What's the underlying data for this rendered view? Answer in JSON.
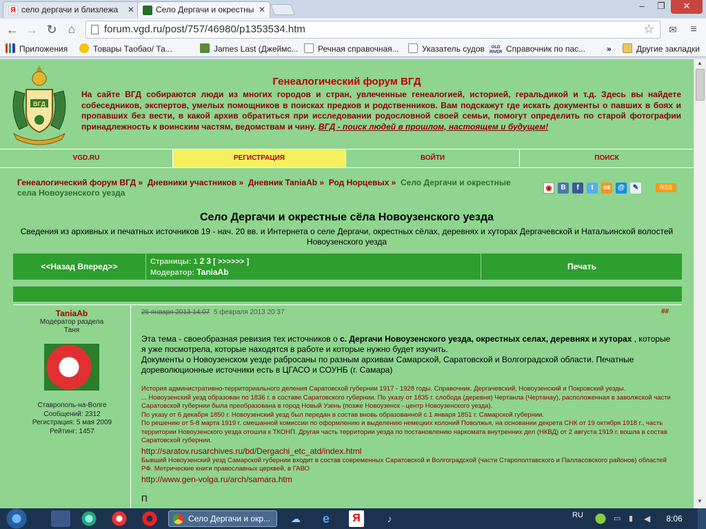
{
  "browser": {
    "tabs": [
      {
        "label": "село дергачи и близлежа",
        "favicon": "yandex-icon"
      },
      {
        "label": "Село Дергачи и окрестны",
        "favicon": "vgd-icon"
      }
    ],
    "url": "forum.vgd.ru/post/757/46980/p1353534.htm",
    "bookmarks": [
      {
        "label": "Приложения",
        "icon": "apps-grid-icon"
      },
      {
        "label": "Товары Таобао/ Та...",
        "icon": "taobao-icon"
      },
      {
        "label": "James Last (Джеймс...",
        "icon": "music-icon"
      },
      {
        "label": "Речная справочная...",
        "icon": "page-icon"
      },
      {
        "label": "Указатель судов",
        "icon": "page-icon"
      },
      {
        "label": "Справочник по пас...",
        "icon": "oldriver-icon"
      },
      {
        "label": "»",
        "icon": ""
      },
      {
        "label": "Другие закладки",
        "icon": "folder-icon"
      }
    ],
    "oldriver_logo": "OLD RIVER"
  },
  "header": {
    "title": "Генеалогический форум ВГД",
    "intro": "На сайте ВГД собираются люди из многих городов и стран, увлеченные генеалогией, историей, геральдикой и т.д. Здесь вы найдете собеседников, экспертов, умелых помощников в поисках предков и родственников. Вам подскажут где искать документы о павших в боях и пропавших без вести, в какой архив обратиться при исследовании родословной своей семьи, помогут определить по старой фотографии принадлежность к воинским частям, ведомствам и чину.",
    "intro_link": "ВГД - поиск людей в прошлом, настоящем и будущем!",
    "logo_text": "ВГД"
  },
  "menu": [
    "VGD.RU",
    "РЕГИСТРАЦИЯ",
    "ВОЙТИ",
    "ПОИСК"
  ],
  "crumbs": [
    "Генеалогический форум ВГД",
    "Дневники участников",
    "Дневник TaniaAb",
    "Род Норцевых",
    "Село Дергачи и окрестные села Новоузенского уезда"
  ],
  "crumb_sep": "»",
  "share": [
    "ВКонтакте",
    "Facebook",
    "Twitter",
    "Одноклассники",
    "Mail.ru",
    "Закладка"
  ],
  "rss": "RSS",
  "topic": {
    "title": "Село Дергачи и окрестные сёла Новоузенского уезда",
    "subtitle": "Сведения из архивных и печатных источников 19 - нач. 20 вв. и Интернета о селе Дергачи, окрестных сёлах, деревнях и хуторах Дергачевской и Натальинской волостей Новоузенского уезда"
  },
  "navbar": {
    "back_forward": "<<Назад  Вперед>>",
    "pages_label": "Страницы:",
    "pages": [
      "1",
      "2",
      "3"
    ],
    "pages_more": "[ >>>>>> ]",
    "moderator_label": "Модератор:",
    "moderator": "TaniaAb",
    "print": "Печать"
  },
  "post": {
    "author": "TaniaAb",
    "role": "Модератор раздела",
    "name": "Таня",
    "location": "Ставрополь-на-Волге",
    "messages": "Сообщений: 2312",
    "registered": "Регистрация: 5 мая 2009",
    "rating": "Рейтинг: 1457",
    "date_old": "26 января 2013 14:07",
    "date_new": "5 февраля 2013 20:37",
    "anchor": "##",
    "para_prefix": "Эта тема - своеобразная ревизия тех источников о ",
    "para_bold": "с. Дергачи Новоузенского уезда, окрестных селах, деревнях и хуторах",
    "para_suffix": ", которые я уже посмотрела, которые находятся в работе и которые нужно будет изучить.",
    "para2": "Документы о Новоузенском уезде рабросаны по разным архивам Самарской, Саратовской и Волгоградской области. Печатные дореволюционные источники есть в ЦГАСО и СОУНБ (г. Самара)",
    "quote1": "История административно-территориального деления Саратовской губернии 1917 - 1928 годы. Справочник. Дергачевский, Новоузенский и Покровский уезды.",
    "quote2": "... Новоузенский уезд образован по 1836 г. в составе Саратовского губернии. По указу от 1835 г. слобода (деревня) Чертанла (Чертанау), расположенная в заволжской части Саратовской губернии была преобразована в город Новый Узень (позже Новоузенск - центр Новоузенского уезда).",
    "quote3": "По указу от 6 декабря 1850 г. Новоузенский уезд был передан в состав вновь образованной с 1 января 1851 г. Самарской губернии.",
    "quote4": "По решению от 5-8 марта 1919 г. смешанной комиссии по оформлению и выделению немецких колоний Поволжья, на основании декрета СНК от 19 октября 1918 г., часть территории Новоузенского уезда отошла к ТКОНП. Другая часть территории уезда по постановлению наркомата внутренних дел (НКВД) от 2 августа 1919 г. вошла в состав Саратовской губернии.",
    "link1": "http://saratov.rusarchives.ru/bd/Dergachi_etc_atd/index.html",
    "quote5": "Бывший Новоузенский уезд Самарской губернии входит в состав современных Саратовской и Волгоградской (части Старополтавского и Палласовского районов) областей РФ. Метрические книги православных церквей, в ГАВО",
    "link2": "http://www.gen-volga.ru/arch/samara.htm",
    "cut": "П"
  },
  "taskbar": {
    "active_window": "Село Дергачи и окр...",
    "lang": "RU",
    "time": "8:06"
  }
}
